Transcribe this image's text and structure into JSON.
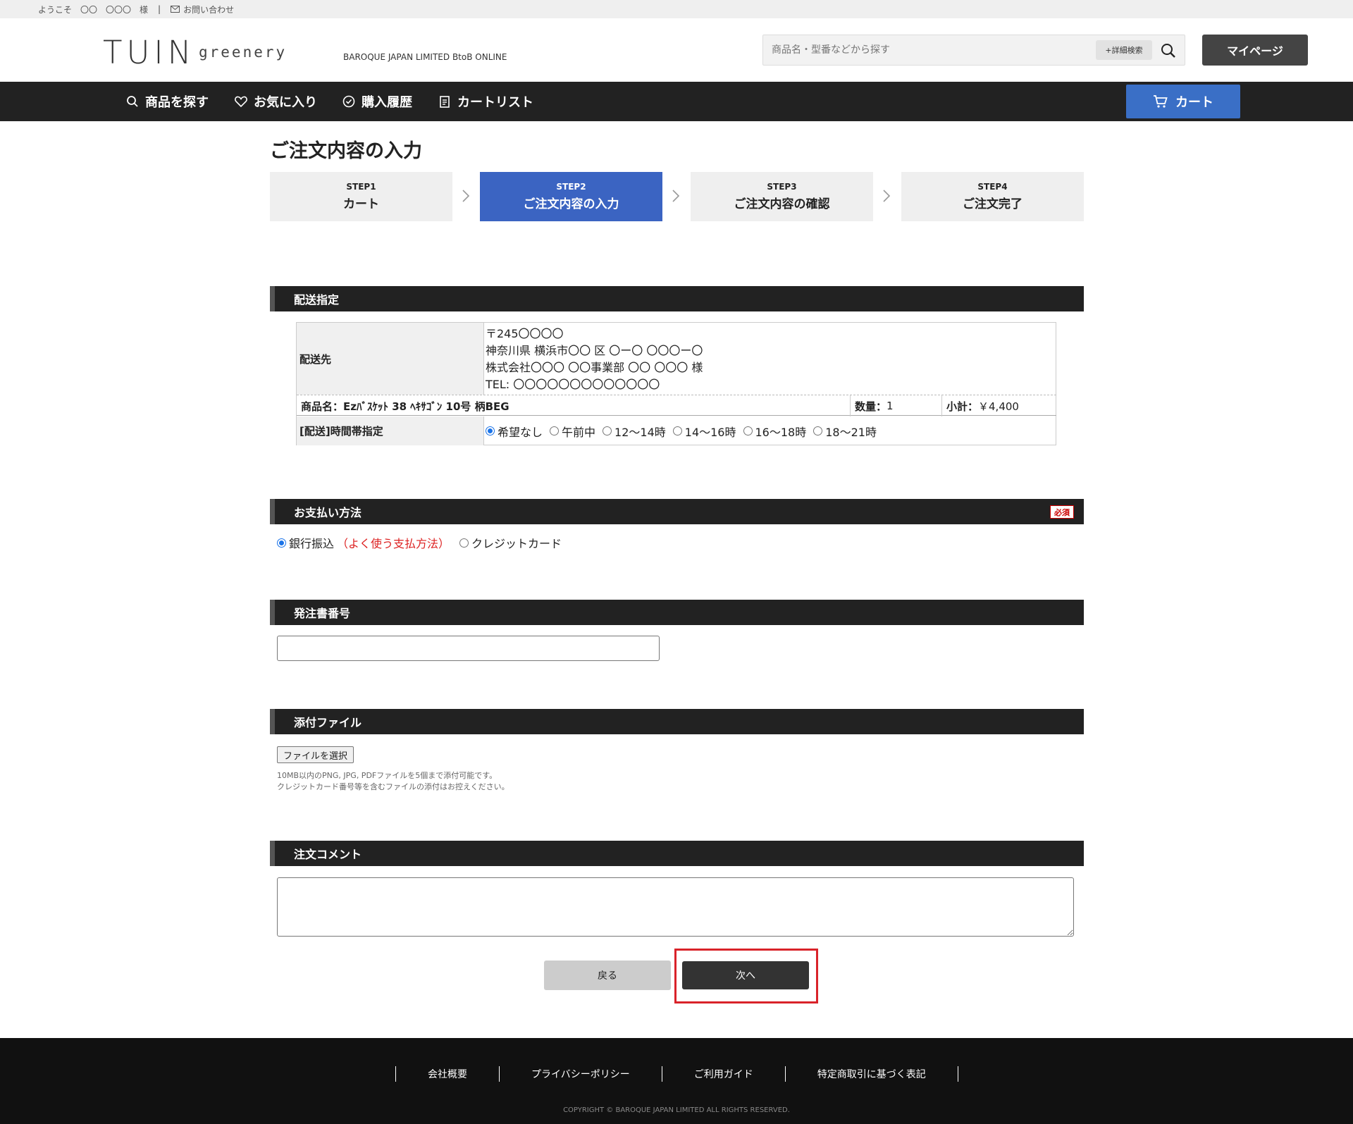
{
  "topbar": {
    "welcome": "ようこそ　〇〇　〇〇〇　様",
    "separator": "|",
    "contact": "お問い合わせ"
  },
  "header": {
    "logo_main": "TUIN",
    "logo_sub": "greenery",
    "tagline": "BAROQUE JAPAN LIMITED BtoB ONLINE",
    "search_placeholder": "商品名・型番などから探す",
    "advanced_search": "+詳細検索",
    "mypage": "マイページ"
  },
  "nav": {
    "items": [
      {
        "label": "商品を探す",
        "icon": "search-icon"
      },
      {
        "label": "お気に入り",
        "icon": "heart-icon"
      },
      {
        "label": "購入履歴",
        "icon": "clock-icon"
      },
      {
        "label": "カートリスト",
        "icon": "clipboard-icon"
      }
    ],
    "cart": "カート"
  },
  "page_title": "ご注文内容の入力",
  "steps": [
    {
      "num": "STEP1",
      "label": "カート",
      "active": false
    },
    {
      "num": "STEP2",
      "label": "ご注文内容の入力",
      "active": true
    },
    {
      "num": "STEP3",
      "label": "ご注文内容の確認",
      "active": false
    },
    {
      "num": "STEP4",
      "label": "ご注文完了",
      "active": false
    }
  ],
  "shipping": {
    "section_title": "配送指定",
    "dest_label": "配送先",
    "address_lines": [
      "〒245〇〇〇〇",
      "神奈川県 横浜市〇〇 区 〇ー〇 〇〇〇ー〇",
      "株式会社〇〇〇 〇〇事業部 〇〇 〇〇〇  様",
      "TEL: 〇〇〇〇〇〇〇〇〇〇〇〇〇"
    ],
    "product": "商品名：Ezﾊﾞｽｹｯﾄ 38 ﾍｷｻｺﾞﾝ 10号 柄BEG",
    "qty_label": "数量：",
    "qty": "1",
    "subtotal_label": "小計：",
    "subtotal": "￥4,400",
    "time_label": "[配送]時間帯指定",
    "time_options": [
      "希望なし",
      "午前中",
      "12～14時",
      "14～16時",
      "16～18時",
      "18～21時"
    ],
    "time_selected": "希望なし"
  },
  "payment": {
    "section_title": "お支払い方法",
    "required": "必須",
    "options": [
      {
        "label": "銀行振込",
        "note": "（よく使う支払方法）",
        "selected": true
      },
      {
        "label": "クレジットカード",
        "note": "",
        "selected": false
      }
    ]
  },
  "po": {
    "section_title": "発注書番号",
    "value": ""
  },
  "attach": {
    "section_title": "添付ファイル",
    "button": "ファイルを選択",
    "note1": "10MB以内のPNG, JPG, PDFファイルを5個まで添付可能です。",
    "note2": "クレジットカード番号等を含むファイルの添付はお控えください。"
  },
  "comment": {
    "section_title": "注文コメント",
    "value": ""
  },
  "buttons": {
    "back": "戻る",
    "next": "次へ"
  },
  "footer": {
    "links": [
      "会社概要",
      "プライバシーポリシー",
      "ご利用ガイド",
      "特定商取引に基づく表記"
    ],
    "copyright": "COPYRIGHT © BAROQUE JAPAN LIMITED ALL RIGHTS RESERVED."
  },
  "colors": {
    "nav_bg": "#222222",
    "accent_blue": "#3b64c2",
    "highlight_red": "#d9232a"
  }
}
